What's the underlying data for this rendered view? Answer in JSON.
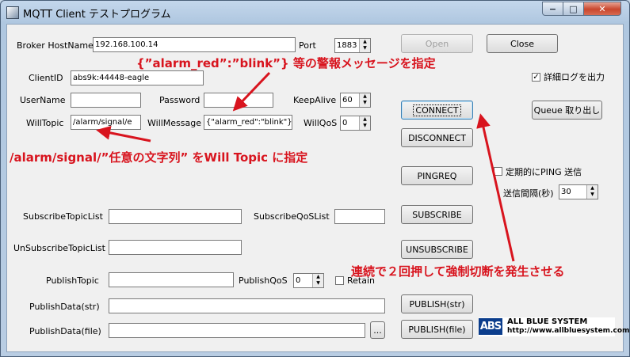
{
  "window": {
    "title": "MQTT Client テストプログラム",
    "min": "−",
    "max": "□",
    "close": "✕"
  },
  "broker": {
    "host_label": "Broker HostName",
    "host_value": "192.168.100.14",
    "port_label": "Port",
    "port_value": "1883"
  },
  "buttons": {
    "open": "Open",
    "close": "Close",
    "connect": "CONNECT",
    "disconnect": "DISCONNECT",
    "queue": "Queue 取り出し",
    "pingreq": "PINGREQ",
    "subscribe": "SUBSCRIBE",
    "unsubscribe": "UNSUBSCRIBE",
    "publish_str": "PUBLISH(str)",
    "publish_file": "PUBLISH(file)",
    "browse": "..."
  },
  "client": {
    "id_label": "ClientID",
    "id_value": "abs9k:44448-eagle",
    "username_label": "UserName",
    "username_value": "",
    "password_label": "Password",
    "password_value": "",
    "keepalive_label": "KeepAlive",
    "keepalive_value": "60"
  },
  "will": {
    "topic_label": "WillTopic",
    "topic_value": "/alarm/signal/e",
    "message_label": "WillMessage",
    "message_value": "{\"alarm_red\":\"blink\"}",
    "qos_label": "WillQoS",
    "qos_value": "0"
  },
  "options": {
    "detail_log_label": "詳細ログを出力",
    "detail_log_checked": true,
    "periodic_ping_label": "定期的にPING 送信",
    "periodic_ping_checked": false,
    "interval_label": "送信間隔(秒)",
    "interval_value": "30"
  },
  "subscribe": {
    "topic_label": "SubscribeTopicList",
    "topic_value": "",
    "qos_label": "SubscribeQoSList",
    "qos_value": ""
  },
  "unsubscribe": {
    "topic_label": "UnSubscribeTopicList",
    "topic_value": ""
  },
  "publish": {
    "topic_label": "PublishTopic",
    "topic_value": "",
    "qos_label": "PublishQoS",
    "qos_value": "0",
    "retain_label": "Retain",
    "retain_checked": false,
    "data_str_label": "PublishData(str)",
    "data_str_value": "",
    "data_file_label": "PublishData(file)",
    "data_file_value": ""
  },
  "annotations": {
    "will_message": "{”alarm_red”:”blink”} 等の警報メッセージを指定",
    "will_topic": "/alarm/signal/”任意の文字列” をWill Topic に指定",
    "connect": "連続で２回押して強制切断を発生させる",
    "color": "#d8141e"
  },
  "logo": {
    "mark": "ABS",
    "name": "ALL BLUE SYSTEM",
    "url": "http://www.allbluesystem.com"
  }
}
